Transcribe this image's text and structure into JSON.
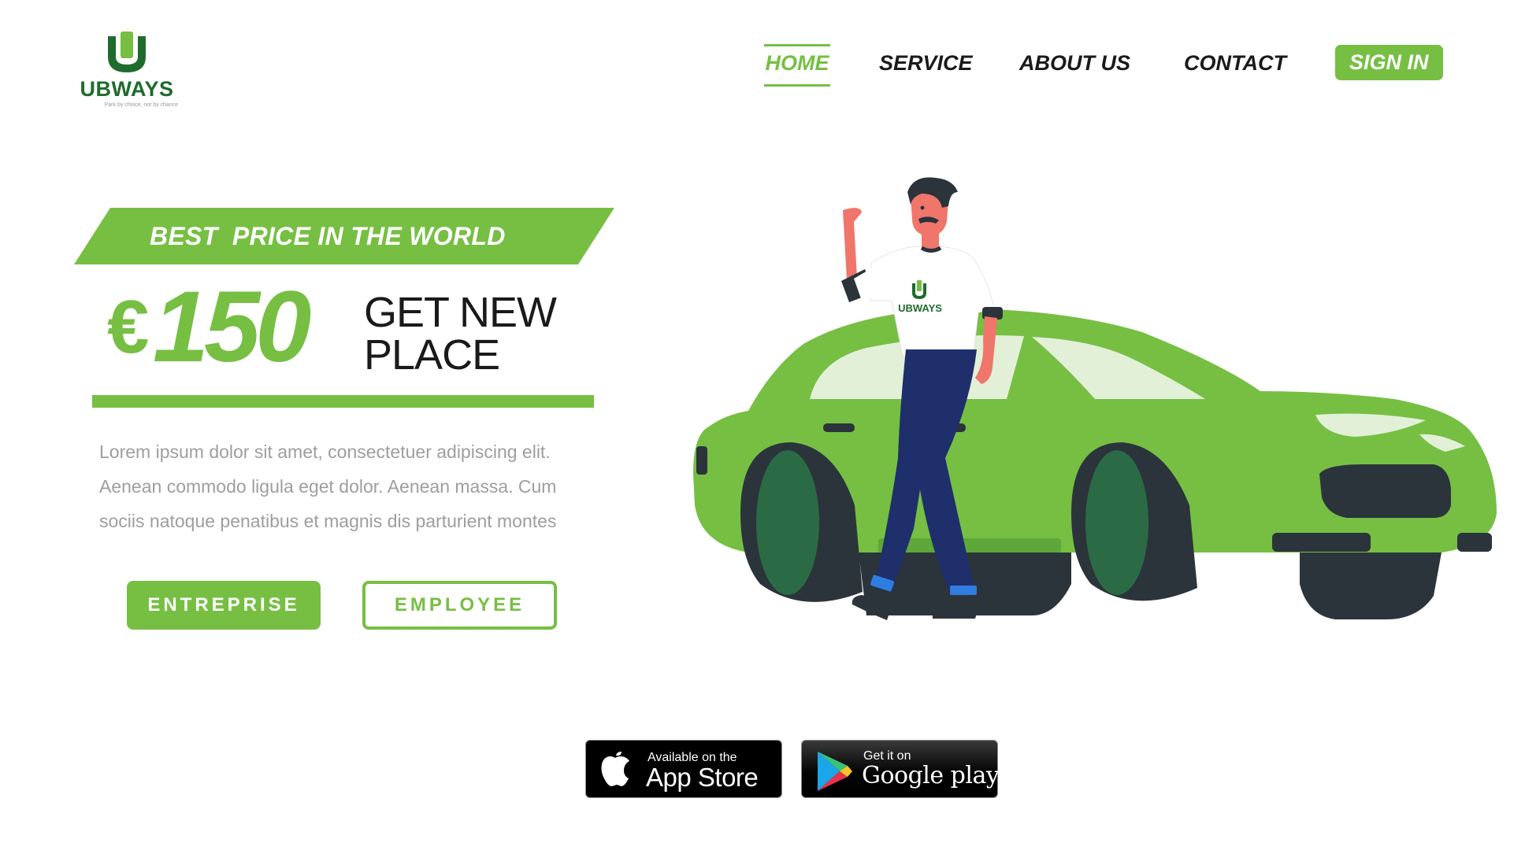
{
  "brand": {
    "name": "UBWAYS",
    "tagline": "Park by choice, not by chance",
    "color_primary": "#76bf43",
    "color_dark": "#1f6b2e"
  },
  "nav": {
    "home": "HOME",
    "service": "SERVICE",
    "about": "ABOUT US",
    "contact": "CONTACT",
    "signin": "SIGN IN",
    "active": "HOME"
  },
  "hero": {
    "ribbon": "BEST  PRICE IN THE WORLD",
    "price_currency": "€",
    "price_amount": "150",
    "tagline_line1": "GET NEW",
    "tagline_line2": "PLACE",
    "description_lines": [
      "Lorem ipsum dolor sit amet, consectetuer adipiscing elit.",
      "Aenean commodo ligula eget dolor. Aenean massa. Cum",
      "sociis natoque penatibus et magnis dis parturient montes"
    ],
    "buttons": {
      "entreprise": "ENTREPRISE",
      "employee": "EMPLOYEE"
    }
  },
  "illustration": {
    "shirt_logo_text": "UBWAYS",
    "car_color": "#76bf43",
    "wheel_color": "#2a6b45"
  },
  "stores": {
    "appstore": {
      "small": "Available on the",
      "big": "App Store",
      "icon": "apple-icon"
    },
    "google": {
      "small": "Get it on",
      "big": "Google play",
      "icon": "google-play-icon"
    }
  }
}
